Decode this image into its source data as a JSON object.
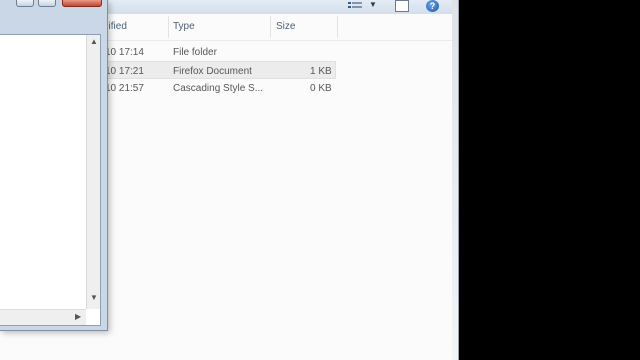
{
  "columns": {
    "modified": "dified",
    "type": "Type",
    "size": "Size"
  },
  "rows": [
    {
      "modified": "10 17:14",
      "type": "File folder",
      "size": "",
      "selected": false
    },
    {
      "modified": "10 17:21",
      "type": "Firefox Document",
      "size": "1 KB",
      "selected": true
    },
    {
      "modified": "10 21:57",
      "type": "Cascading Style S...",
      "size": "0 KB",
      "selected": false
    }
  ],
  "toolbar": {
    "view_icon": "details-view-icon",
    "view_arrow": "▼",
    "preview_icon": "preview-pane-icon",
    "help_label": "?"
  },
  "dialog": {
    "vscroll_up": "▲",
    "vscroll_down": "▼",
    "hscroll_right": "▶"
  }
}
